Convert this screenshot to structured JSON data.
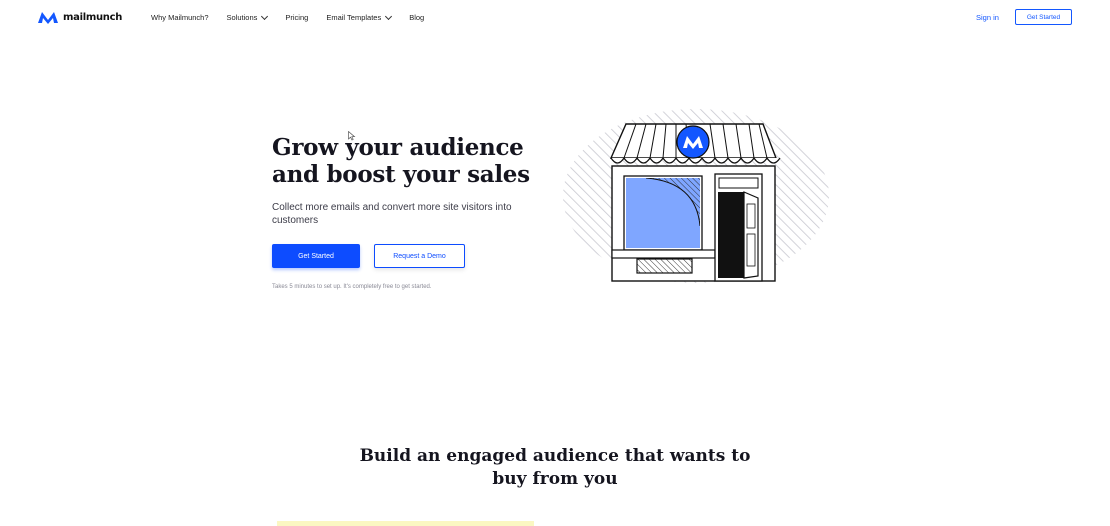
{
  "nav": {
    "brand": "mailmunch",
    "links": [
      {
        "label": "Why Mailmunch?",
        "dropdown": false
      },
      {
        "label": "Solutions",
        "dropdown": true
      },
      {
        "label": "Pricing",
        "dropdown": false
      },
      {
        "label": "Email Templates",
        "dropdown": true
      },
      {
        "label": "Blog",
        "dropdown": false
      }
    ],
    "signin": "Sign in",
    "cta": "Get Started"
  },
  "hero": {
    "title_line1": "Grow your audience",
    "title_line2": "and boost your sales",
    "subtitle": "Collect more emails and convert more site visitors into customers",
    "primary_button": "Get Started",
    "secondary_button": "Request a Demo",
    "note": "Takes 5 minutes to set up. It's completely free to get started."
  },
  "section": {
    "title_line1": "Build an engaged audience that wants to",
    "title_line2": "buy from you"
  },
  "colors": {
    "brand_blue": "#0d4cff",
    "illustration_blue": "#7fa6ff",
    "strip_yellow": "#fbf7c2"
  }
}
